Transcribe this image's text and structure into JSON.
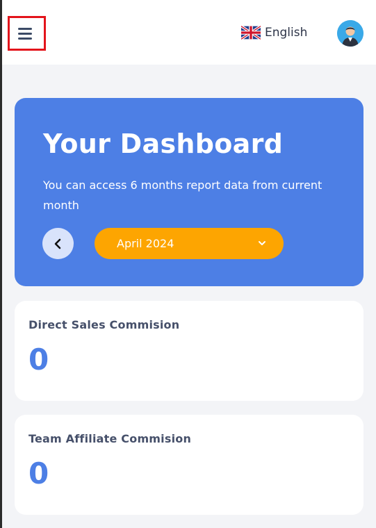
{
  "header": {
    "menu_icon": "hamburger-menu-icon",
    "language_label": "English",
    "flag_icon": "uk-flag-icon",
    "avatar_icon": "user-avatar-icon"
  },
  "hero": {
    "title": "Your Dashboard",
    "subtitle": "You can access 6 months report data from current month",
    "prev_icon": "chevron-left-icon",
    "selected_month": "April 2024",
    "dropdown_icon": "chevron-down-icon"
  },
  "cards": [
    {
      "label": "Direct Sales Commision",
      "value": "0"
    },
    {
      "label": "Team Affiliate Commision",
      "value": "0"
    }
  ],
  "colors": {
    "primary": "#4d7fe5",
    "accent": "#fda501",
    "highlight_border": "#e3141b",
    "background": "#f3f4f7"
  }
}
